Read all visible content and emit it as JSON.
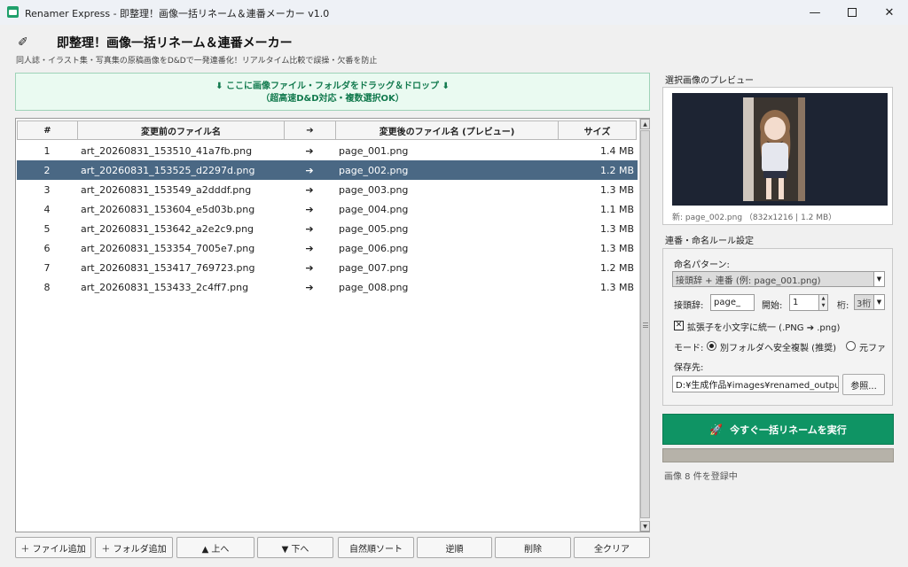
{
  "window": {
    "title": "Renamer Express - 即整理！画像一括リネーム＆連番メーカー v1.0",
    "minimize_glyph": "—",
    "close_glyph": "✕"
  },
  "header": {
    "icon": "pencil-icon",
    "title": "即整理！画像一括リネーム＆連番メーカー",
    "subtitle": "同人誌・イラスト集・写真集の原稿画像をD&Dで一発連番化！リアルタイム比較で誤操・欠番を防止"
  },
  "dropzone": {
    "line1": "⬇ ここに画像ファイル・フォルダをドラッグ＆ドロップ ⬇",
    "line2": "（超高速D&D対応・複数選択OK）"
  },
  "table": {
    "columns": [
      "#",
      "変更前のファイル名",
      "➔",
      "変更後のファイル名 (プレビュー)",
      "サイズ"
    ],
    "rows": [
      {
        "num": "1",
        "old": "art_20260831_153510_41a7fb.png",
        "arrow": "➔",
        "new": "page_001.png",
        "size": "1.4 MB"
      },
      {
        "num": "2",
        "old": "art_20260831_153525_d2297d.png",
        "arrow": "➔",
        "new": "page_002.png",
        "size": "1.2 MB"
      },
      {
        "num": "3",
        "old": "art_20260831_153549_a2dddf.png",
        "arrow": "➔",
        "new": "page_003.png",
        "size": "1.3 MB"
      },
      {
        "num": "4",
        "old": "art_20260831_153604_e5d03b.png",
        "arrow": "➔",
        "new": "page_004.png",
        "size": "1.1 MB"
      },
      {
        "num": "5",
        "old": "art_20260831_153642_a2e2c9.png",
        "arrow": "➔",
        "new": "page_005.png",
        "size": "1.3 MB"
      },
      {
        "num": "6",
        "old": "art_20260831_153354_7005e7.png",
        "arrow": "➔",
        "new": "page_006.png",
        "size": "1.3 MB"
      },
      {
        "num": "7",
        "old": "art_20260831_153417_769723.png",
        "arrow": "➔",
        "new": "page_007.png",
        "size": "1.2 MB"
      },
      {
        "num": "8",
        "old": "art_20260831_153433_2c4ff7.png",
        "arrow": "➔",
        "new": "page_008.png",
        "size": "1.3 MB"
      }
    ],
    "selected_index": 1
  },
  "buttons": {
    "add_file": "＋ ファイル追加",
    "add_folder": "＋ フォルダ追加",
    "move_up": "▲ 上へ",
    "move_down": "▼ 下へ",
    "natural_sort": "自然順ソート",
    "reverse": "逆順",
    "delete": "削除",
    "clear_all": "全クリア"
  },
  "preview": {
    "label": "選択画像のプレビュー",
    "caption": "新: page_002.png （832x1216 | 1.2 MB）"
  },
  "rules": {
    "label": "連番・命名ルール設定",
    "pattern_label": "命名パターン:",
    "pattern_value": "接頭辞 + 連番 (例: page_001.png)",
    "prefix_label": "接頭辞:",
    "prefix_value": "page_",
    "start_label": "開始:",
    "start_value": "1",
    "digits_label": "桁:",
    "digits_value": "3桁",
    "lowercase_ext_label": "拡張子を小文字に統一 (.PNG ➔ .png)",
    "lowercase_ext_checked": true,
    "mode_label": "モード:",
    "mode_option1": "別フォルダへ安全複製 (推奨)",
    "mode_option2": "元ファ",
    "save_label": "保存先:",
    "save_value": "D:¥生成作品¥images¥renamed_output",
    "browse": "参照..."
  },
  "run": {
    "icon": "rocket-icon",
    "label": "今すぐ一括リネームを実行"
  },
  "progress": {
    "value": 0
  },
  "status": "画像 8 件を登録中",
  "colors": {
    "accent": "#0f9464",
    "selected_row": "#4a6884",
    "dropzone_bg": "#eafaf1",
    "dropzone_text": "#127a4e"
  }
}
